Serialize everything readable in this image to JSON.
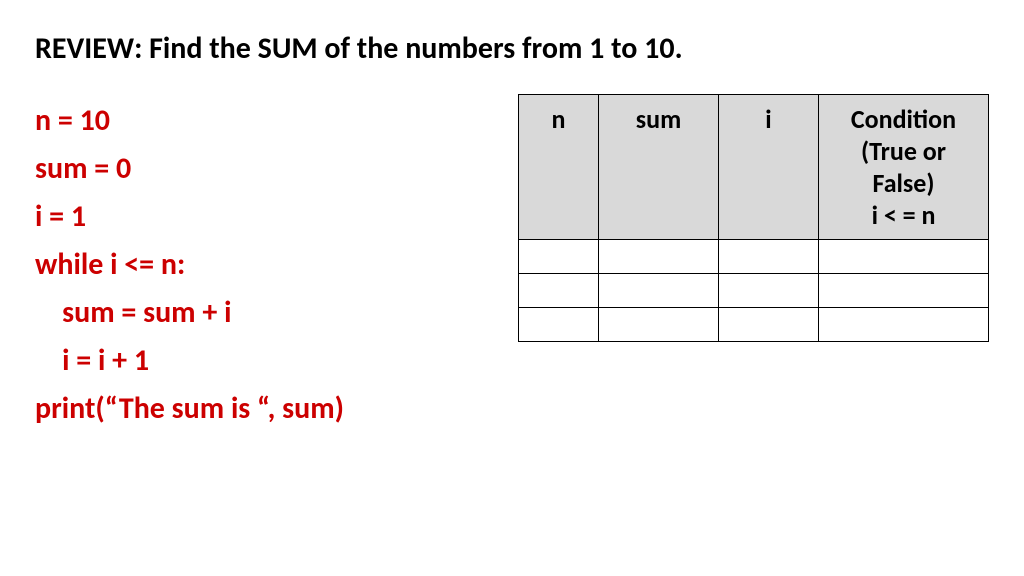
{
  "title": "REVIEW: Find the SUM of the numbers from 1 to 10.",
  "code": {
    "lines": [
      "n = 10",
      "sum = 0",
      "i = 1",
      "while i <= n:",
      "    sum = sum + i",
      "    i = i + 1",
      "print(“The sum is “, sum)"
    ]
  },
  "table": {
    "headers": {
      "n": "n",
      "sum": "sum",
      "i": "i",
      "condition": "Condition (True or False)\ni < = n"
    },
    "rows": [
      {
        "n": "",
        "sum": "",
        "i": "",
        "condition": ""
      },
      {
        "n": "",
        "sum": "",
        "i": "",
        "condition": ""
      },
      {
        "n": "",
        "sum": "",
        "i": "",
        "condition": ""
      }
    ]
  }
}
